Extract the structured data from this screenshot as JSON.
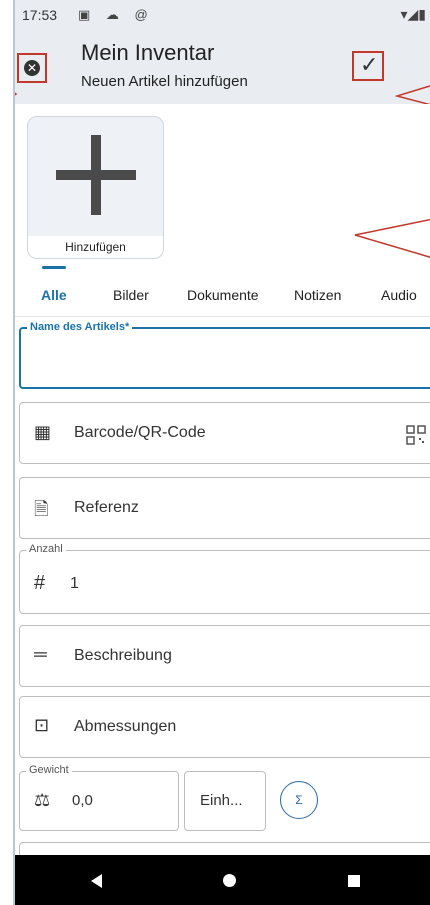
{
  "status_bar": {
    "time": "17:53",
    "icons": "▣ ☁ @",
    "right": "▾◢▮"
  },
  "header": {
    "title": "Mein Inventar",
    "subtitle": "Neuen Artikel hinzufügen",
    "close_icon": "close-circle-icon",
    "confirm_icon": "check-icon",
    "close_symbol": "✕",
    "confirm_symbol": "✓"
  },
  "images": {
    "add_label": "Hinzufügen"
  },
  "tabs": [
    {
      "label": "Alle",
      "active": true
    },
    {
      "label": "Bilder"
    },
    {
      "label": "Dokumente"
    },
    {
      "label": "Notizen"
    },
    {
      "label": "Audio"
    }
  ],
  "form": {
    "name": {
      "label": "Name des Artikels*",
      "value": ""
    },
    "barcode": {
      "label": "Barcode/QR-Code",
      "icon": "▦"
    },
    "reference": {
      "label": "Referenz",
      "icon": "🗎"
    },
    "quantity": {
      "label": "Anzahl",
      "value": "1",
      "icon": "#"
    },
    "description": {
      "label": "Beschreibung",
      "icon": "═"
    },
    "dimensions": {
      "label": "Abmessungen",
      "icon": "⊡"
    },
    "weight": {
      "label": "Gewicht",
      "value": "0,0",
      "unit": "Einh...",
      "calc": "Σ",
      "icon": "⚖"
    }
  },
  "colors": {
    "accent": "#1a73a8",
    "annotation": "#c0392b",
    "header_bg": "#e9edf2"
  }
}
